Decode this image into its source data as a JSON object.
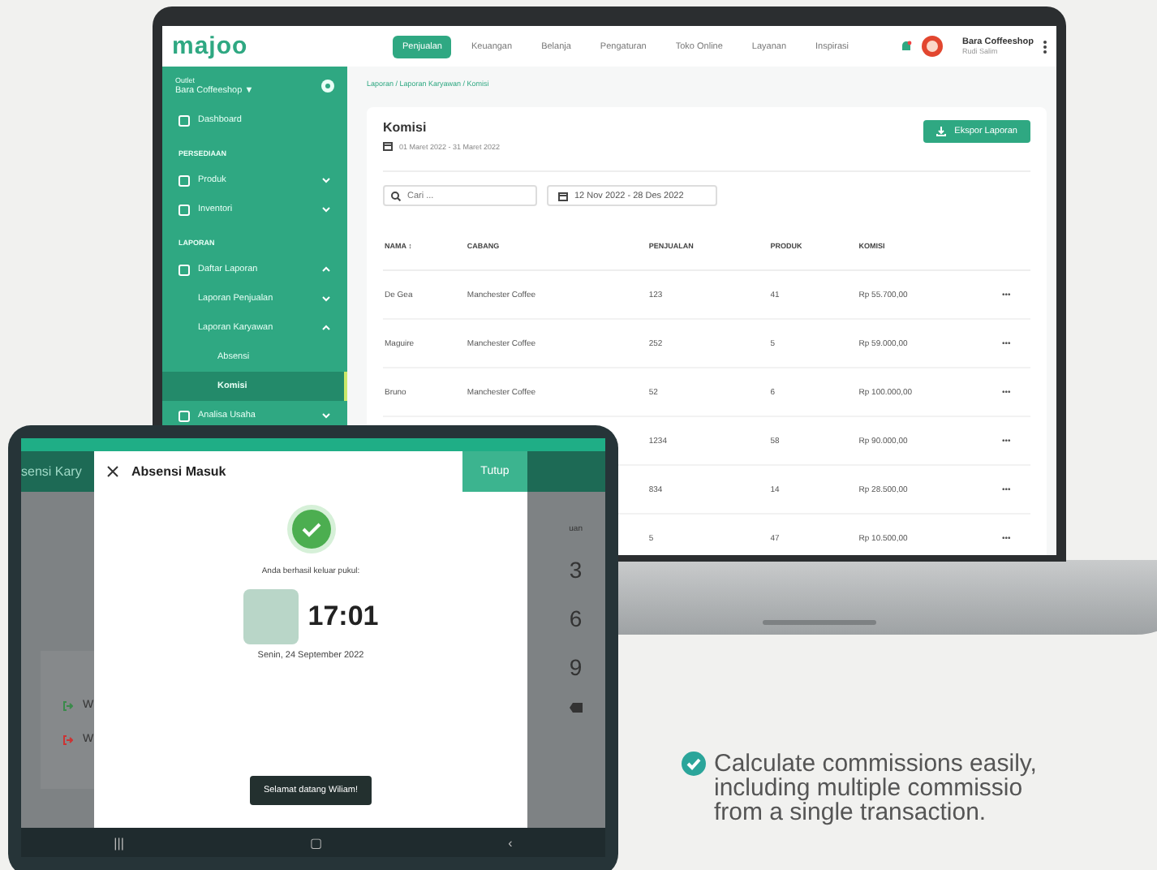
{
  "laptop": {
    "logo": "majoo",
    "nav": [
      {
        "label": "Penjualan",
        "selected": true
      },
      {
        "label": "Keuangan",
        "selected": false
      },
      {
        "label": "Belanja",
        "selected": false
      },
      {
        "label": "Pengaturan",
        "selected": false
      },
      {
        "label": "Toko Online",
        "selected": false
      },
      {
        "label": "Layanan",
        "selected": false
      },
      {
        "label": "Inspirasi",
        "selected": false
      }
    ],
    "profile": {
      "name": "Bara Coffeeshop",
      "user": "Rudi Salim"
    },
    "sidebar": {
      "outlet_label": "Outlet",
      "outlet": "Bara Coffeeshop ▼",
      "items": [
        {
          "kind": "item",
          "label": "Dashboard",
          "selected": false
        },
        {
          "kind": "section",
          "label": "PERSEDIAAN"
        },
        {
          "kind": "item",
          "label": "Produk",
          "expanded": false,
          "selected": false
        },
        {
          "kind": "item",
          "label": "Inventori",
          "expanded": false,
          "selected": false
        },
        {
          "kind": "section",
          "label": "LAPORAN"
        },
        {
          "kind": "item",
          "label": "Daftar Laporan",
          "expanded": true,
          "selected": false,
          "children": [
            {
              "kind": "item",
              "label": "Laporan Penjualan",
              "expanded": false,
              "selected": false
            },
            {
              "kind": "item",
              "label": "Laporan Karyawan",
              "expanded": true,
              "selected": false,
              "children": [
                {
                  "kind": "item",
                  "label": "Absensi",
                  "selected": false
                },
                {
                  "kind": "item",
                  "label": "Komisi",
                  "selected": true
                }
              ]
            }
          ]
        },
        {
          "kind": "item",
          "label": "Analisa Usaha",
          "expanded": false,
          "selected": false
        }
      ]
    },
    "breadcrumb": "Laporan / Laporan Karyawan / Komisi",
    "title": "Komisi",
    "period": "01 Maret 2022 - 31 Maret 2022",
    "export_button": "Ekspor Laporan",
    "search": {
      "placeholder": "Cari ..."
    },
    "date_range": "12 Nov 2022 - 28 Des 2022",
    "table": {
      "columns": [
        "NAMA ↕",
        "CABANG",
        "PENJUALAN",
        "PRODUK",
        "KOMISI"
      ],
      "rows": [
        {
          "cells": [
            "De Gea",
            "Manchester Coffee",
            "123",
            "41",
            "Rp 55.700,00"
          ],
          "menu": "•••"
        },
        {
          "cells": [
            "Maguire",
            "Manchester Coffee",
            "252",
            "5",
            "Rp 59.000,00"
          ],
          "menu": "•••"
        },
        {
          "cells": [
            "Bruno",
            "Manchester Coffee",
            "52",
            "6",
            "Rp 100.000,00"
          ],
          "menu": "•••"
        },
        {
          "cells": [
            "",
            "",
            "1234",
            "58",
            "Rp 90.000,00"
          ],
          "menu": "•••"
        },
        {
          "cells": [
            "",
            "",
            "834",
            "14",
            "Rp 28.500,00"
          ],
          "menu": "•••"
        },
        {
          "cells": [
            "",
            "",
            "5",
            "47",
            "Rp 10.500,00"
          ],
          "menu": "•••"
        }
      ]
    }
  },
  "tablet": {
    "header_text": "sensi Kary",
    "side_rows": [
      "W",
      "W"
    ],
    "side_label": "uan",
    "keys": [
      "3",
      "6",
      "9"
    ],
    "dialog": {
      "title": "Absensi Masuk",
      "close_button": "Tutup",
      "message": "Anda berhasil keluar pukul:",
      "time": "17:01",
      "date": "Senin, 24 September 2022",
      "welcome": "Selamat datang Wiliam!"
    },
    "nav_buttons": [
      "|||",
      "▢",
      "‹"
    ]
  },
  "tagline": [
    "Calculate commissions easily,",
    "including multiple commissio",
    "from a single transaction."
  ]
}
